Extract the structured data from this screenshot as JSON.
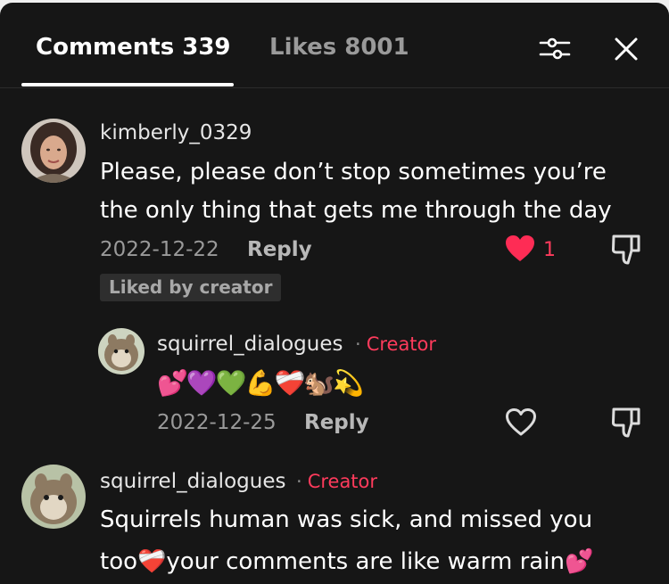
{
  "header": {
    "tab_comments": "Comments 339",
    "tab_likes": "Likes 8001"
  },
  "comments": [
    {
      "username": "kimberly_0329",
      "text_line1": "Please, please don’t stop sometimes you’re",
      "text_line2": "the only thing that gets me through the day",
      "date": "2022-12-22",
      "reply_label": "Reply",
      "like_count": "1",
      "badge": "Liked by creator"
    },
    {
      "username": "squirrel_dialogues",
      "dot": "·",
      "creator_label": "Creator",
      "emojis": "💕💜💚💪❤️‍🩹🐿️💫",
      "date": "2022-12-25",
      "reply_label": "Reply"
    },
    {
      "username": "squirrel_dialogues",
      "dot": "·",
      "creator_label": "Creator",
      "text_line1": "Squirrels human was sick, and missed you",
      "text_line2": "too❤️‍🩹your comments are like warm rain💕"
    }
  ],
  "colors": {
    "background": "#161616",
    "accent": "#fe3b5c",
    "heart": "#fe2c55"
  }
}
